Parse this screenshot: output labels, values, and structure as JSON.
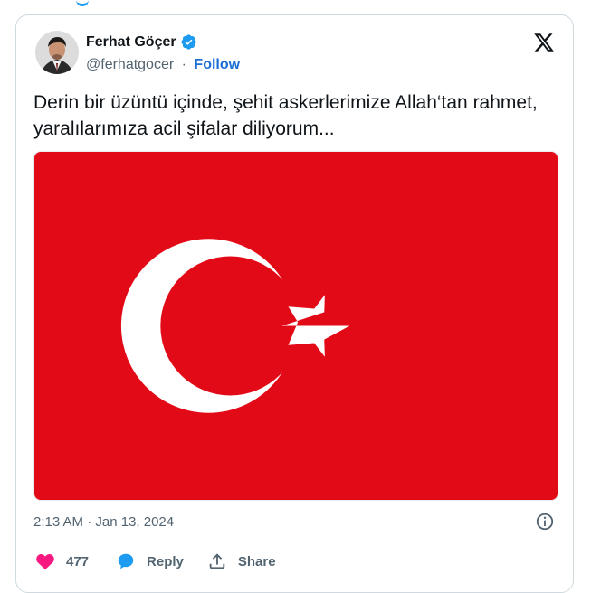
{
  "author": {
    "name": "Ferhat Göçer",
    "handle": "@ferhatgocer",
    "separator": "·",
    "follow_label": "Follow",
    "verified_color": "#1d9bf0"
  },
  "tweet": {
    "text": "Derin bir üzüntü içinde, şehit askerlerimize Allah‘tan rahmet, yaralılarımıza acil şifalar diliyorum...",
    "timestamp": "2:13 AM · Jan 13, 2024",
    "media": {
      "type": "image",
      "subject": "turkish-flag",
      "background_color": "#e30a17",
      "symbol_color": "#ffffff"
    }
  },
  "actions": {
    "likes": "477",
    "reply_label": "Reply",
    "share_label": "Share",
    "like_color": "#f91880",
    "reply_color": "#1d9bf0"
  },
  "icons": [
    "x-logo-icon",
    "verified-badge-icon",
    "info-icon",
    "heart-icon",
    "reply-bubble-icon",
    "share-icon"
  ]
}
